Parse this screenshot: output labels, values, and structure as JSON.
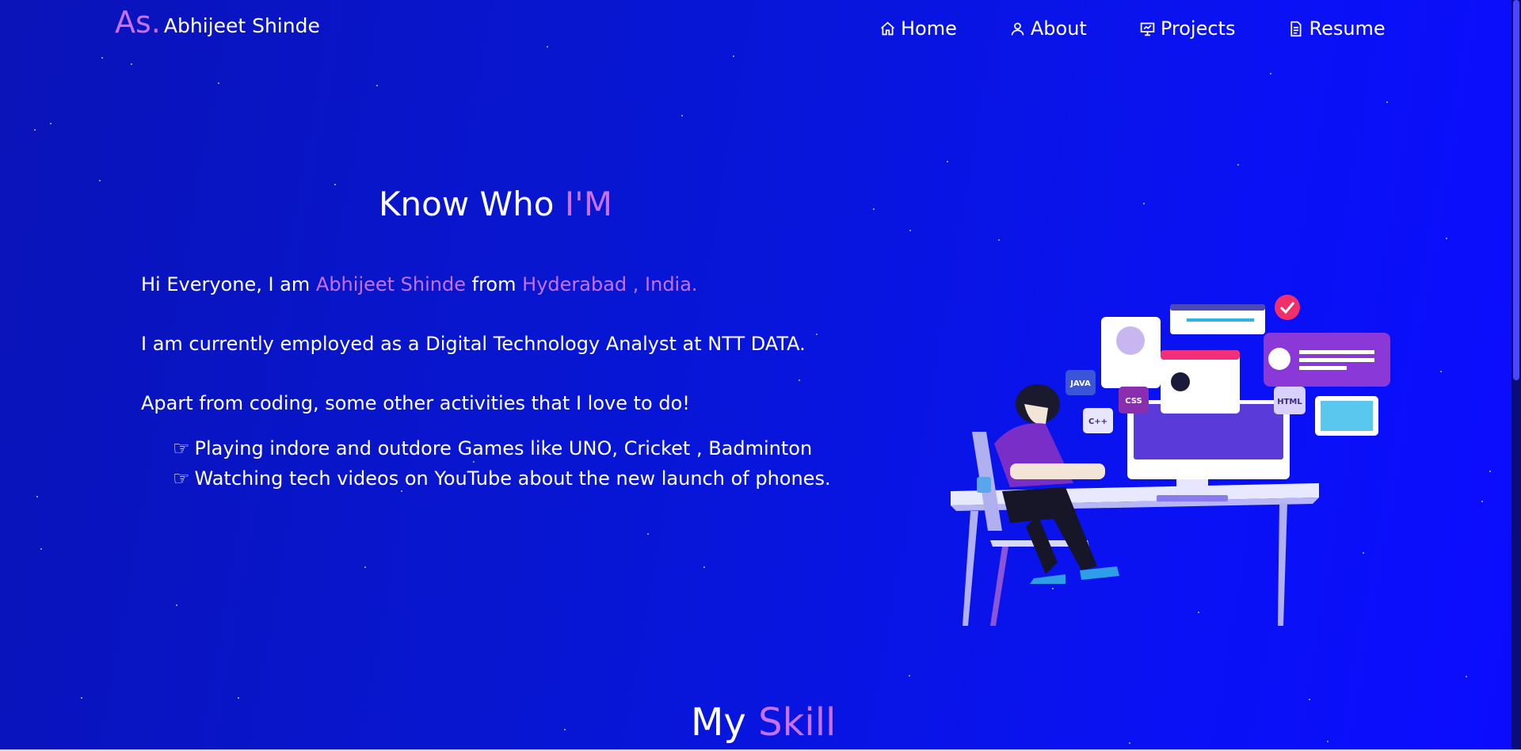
{
  "logo": {
    "mark": "As.",
    "name": "Abhijeet Shinde"
  },
  "nav": [
    {
      "label": "Home",
      "icon": "home-icon"
    },
    {
      "label": "About",
      "icon": "user-icon"
    },
    {
      "label": "Projects",
      "icon": "presentation-icon"
    },
    {
      "label": "Resume",
      "icon": "document-icon"
    }
  ],
  "about": {
    "title_prefix": "Know Who",
    "title_highlight": "I'M",
    "intro_start": "Hi Everyone, I am",
    "intro_name": "Abhijeet Shinde",
    "intro_mid": "from",
    "intro_place": "Hyderabad , India.",
    "job": "I am currently employed as a Digital Technology Analyst at NTT DATA.",
    "hobbies_intro": "Apart from coding, some other activities that I love to do!",
    "hobbies": [
      "Playing indore and outdore Games like UNO, Cricket , Badminton",
      "Watching tech videos on YouTube about the new launch of phones."
    ]
  },
  "illustration": {
    "badges": [
      "JAVA",
      "CSS",
      "HTML",
      "C++"
    ]
  },
  "skills": {
    "title_prefix": "My",
    "title_highlight": "Skill"
  },
  "colors": {
    "accent": "#c770f0",
    "background": "#0716d6"
  }
}
